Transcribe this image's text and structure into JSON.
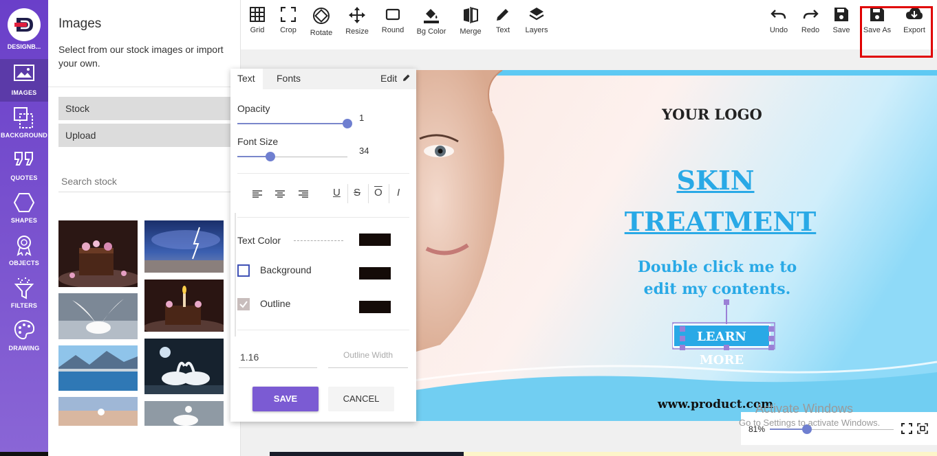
{
  "brand": {
    "name": "DESIGNB..."
  },
  "rail": {
    "items": [
      {
        "label": "IMAGES",
        "icon": "image-icon"
      },
      {
        "label": "BACKGROUND",
        "icon": "background-icon"
      },
      {
        "label": "QUOTES",
        "icon": "quotes-icon"
      },
      {
        "label": "SHAPES",
        "icon": "hexagon-icon"
      },
      {
        "label": "OBJECTS",
        "icon": "badge-icon"
      },
      {
        "label": "FILTERS",
        "icon": "filter-icon"
      },
      {
        "label": "DRAWING",
        "icon": "palette-icon"
      }
    ]
  },
  "side": {
    "title": "Images",
    "description": "Select from our stock images or import your own.",
    "stock_label": "Stock",
    "upload_label": "Upload",
    "search_placeholder": "Search stock"
  },
  "toolbar": {
    "tools": [
      "Grid",
      "Crop",
      "Rotate",
      "Resize",
      "Round",
      "Bg Color",
      "Merge",
      "Text",
      "Layers"
    ],
    "actions": [
      "Undo",
      "Redo",
      "Save",
      "Save As",
      "Export"
    ]
  },
  "text_panel": {
    "tabs": [
      "Text",
      "Fonts"
    ],
    "edit_label": "Edit",
    "opacity_label": "Opacity",
    "opacity_value": "1",
    "opacity_fraction": 1.0,
    "font_size_label": "Font Size",
    "font_size_value": "34",
    "font_size_fraction": 0.3,
    "format": {
      "underline": "U",
      "strike": "S",
      "overline": "O",
      "italic": "I"
    },
    "text_color_label": "Text Color",
    "background_label": "Background",
    "background_checked": false,
    "outline_label": "Outline",
    "outline_checked": true,
    "swatch_color": "#140b08",
    "line_height_value": "1.16",
    "outline_width_placeholder": "Outline Width",
    "save_label": "SAVE",
    "cancel_label": "CANCEL"
  },
  "canvas": {
    "logo_text": "YOUR LOGO",
    "headline_1": "SKIN",
    "headline_2": "TREATMENT",
    "body_1": "Double click me to",
    "body_2": "edit my contents.",
    "cta": "LEARN MORE",
    "url": "www.product.com",
    "accent_color": "#29a9e6"
  },
  "zoom": {
    "value": "81%",
    "fraction": 0.3
  },
  "watermark": {
    "line1": "Activate Windows",
    "line2": "Go to Settings to activate Windows."
  }
}
